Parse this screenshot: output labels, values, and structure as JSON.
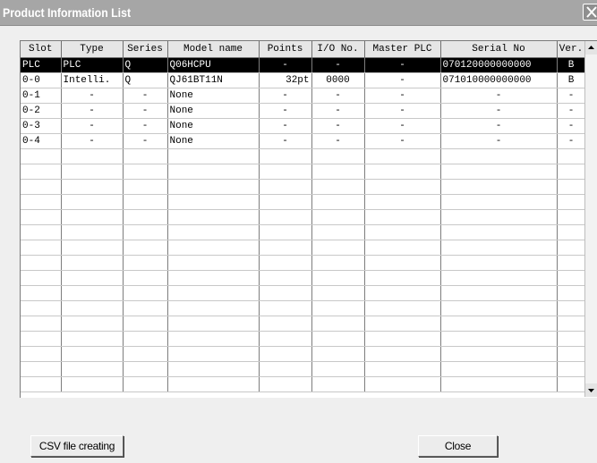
{
  "window": {
    "title": "Product Information List"
  },
  "table": {
    "columns": [
      "Slot",
      "Type",
      "Series",
      "Model name",
      "Points",
      "I/O No.",
      "Master PLC",
      "Serial No",
      "Ver."
    ],
    "rows": [
      {
        "cells": [
          "PLC",
          "PLC",
          "Q",
          "Q06HCPU",
          "-",
          "-",
          "-",
          "070120000000000",
          "B"
        ],
        "selected": true
      },
      {
        "cells": [
          "0-0",
          "Intelli.",
          "Q",
          "QJ61BT11N",
          "32pt",
          "0000",
          "-",
          "071010000000000",
          "B"
        ],
        "selected": false
      },
      {
        "cells": [
          "0-1",
          "-",
          "-",
          "None",
          "-",
          "-",
          "-",
          "-",
          "-"
        ],
        "selected": false
      },
      {
        "cells": [
          "0-2",
          "-",
          "-",
          "None",
          "-",
          "-",
          "-",
          "-",
          "-"
        ],
        "selected": false
      },
      {
        "cells": [
          "0-3",
          "-",
          "-",
          "None",
          "-",
          "-",
          "-",
          "-",
          "-"
        ],
        "selected": false
      },
      {
        "cells": [
          "0-4",
          "-",
          "-",
          "None",
          "-",
          "-",
          "-",
          "-",
          "-"
        ],
        "selected": false
      }
    ],
    "empty_rows": 16
  },
  "buttons": {
    "csv_label": "CSV file creating",
    "close_label": "Close"
  },
  "icons": {
    "close": "close-icon",
    "scroll_up": "arrow-up-icon",
    "scroll_down": "arrow-down-icon"
  }
}
